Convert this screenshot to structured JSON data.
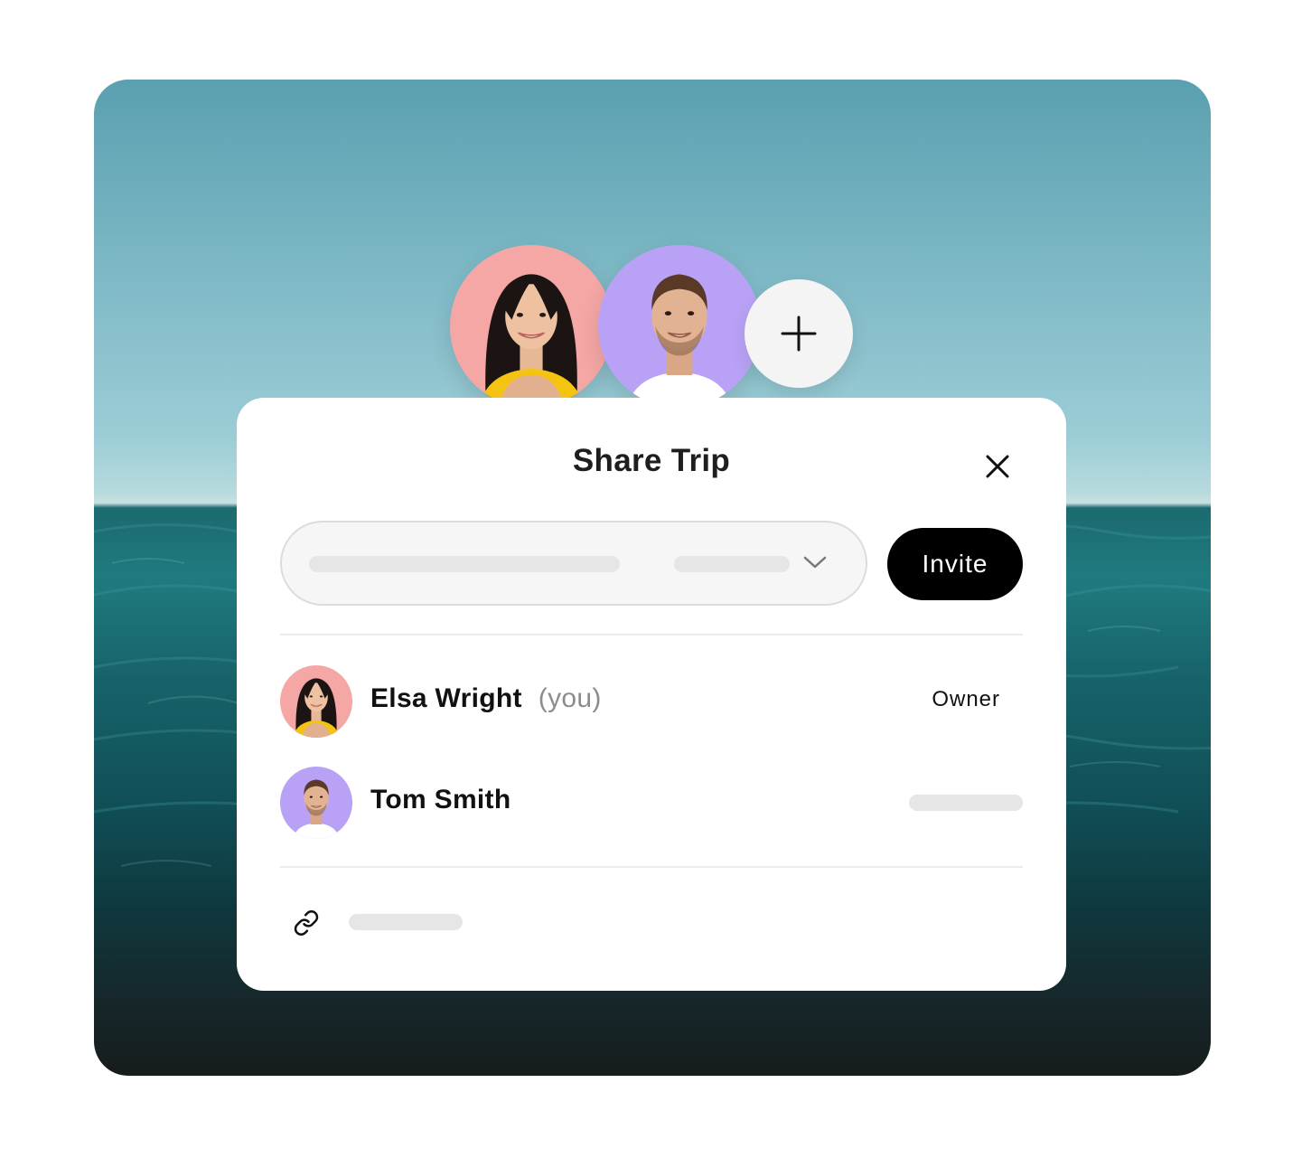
{
  "dialog": {
    "title": "Share Trip",
    "invite_label": "Invite"
  },
  "collaborators": [
    {
      "name": "Elsa Wright",
      "suffix": "(you)",
      "role": "Owner"
    },
    {
      "name": "Tom Smith",
      "suffix": "",
      "role": ""
    }
  ],
  "colors": {
    "elsa_avatar_bg": "#f4a7a5",
    "tom_avatar_bg": "#b9a2f6",
    "invite_button": "#000000",
    "card": "#ffffff"
  },
  "icons": [
    "plus-icon",
    "close-icon",
    "chevron-down-icon",
    "link-icon"
  ]
}
